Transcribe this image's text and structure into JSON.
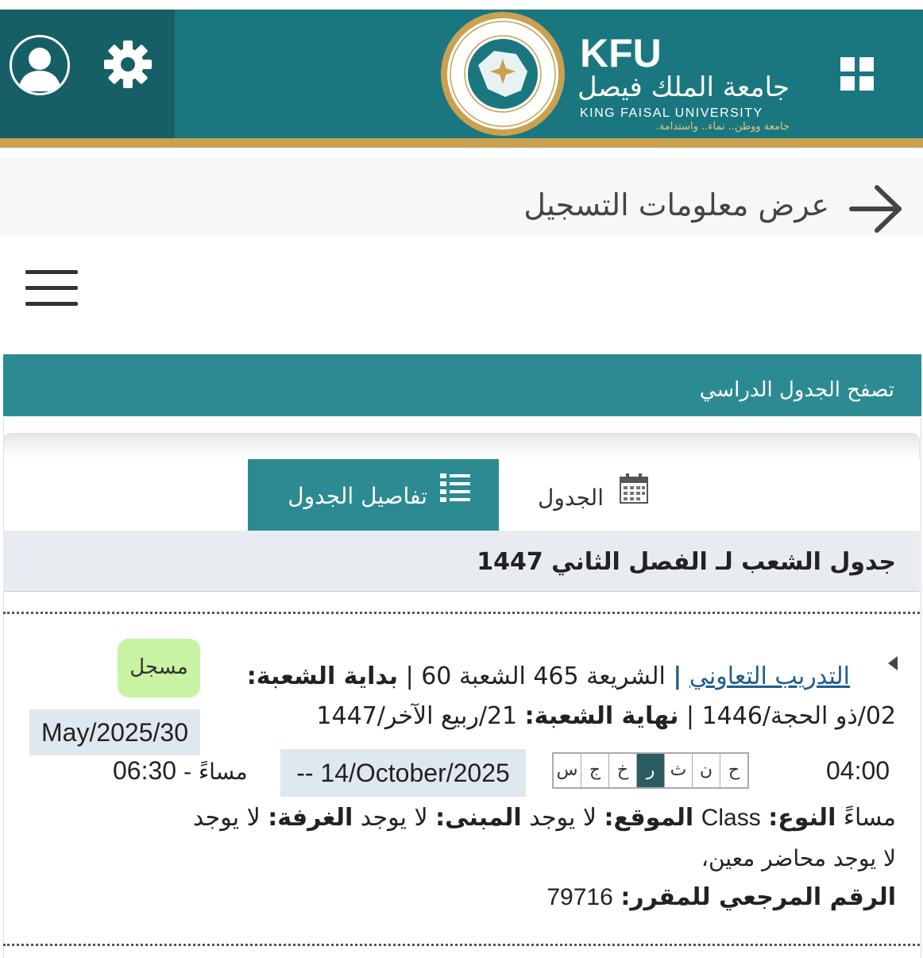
{
  "header": {
    "brand_abbr": "KFU",
    "brand_name_ar": "جامعة الملك فيصل",
    "brand_name_en": "KING FAISAL UNIVERSITY",
    "brand_tagline_ar": "جامعة ووطن.. نماء.. واستدامة.",
    "seal_text_ar": "جامعة الملك فيصل",
    "seal_text_en": "KING FAISAL UNIVERSITY",
    "seal_center": "KFU",
    "colors": {
      "bar": "#1a7780",
      "left_block": "#165f67",
      "gold": "#c9a14f"
    },
    "icons": {
      "avatar": "user-avatar-icon",
      "settings": "gear-icon",
      "apps": "apps-grid-icon"
    }
  },
  "page": {
    "title": "عرض معلومات التسجيل",
    "back_icon": "arrow-right-icon",
    "menu_icon": "hamburger-menu-icon"
  },
  "browse": {
    "title": "تصفح الجدول الدراسي"
  },
  "tabs": {
    "details_label": "تفاصيل الجدول",
    "schedule_label": "الجدول",
    "details_icon": "list-icon",
    "schedule_icon": "calendar-icon",
    "active": "details"
  },
  "term": {
    "title": "جدول الشعب لـ الفصل الثاني 1447"
  },
  "course": {
    "name": "التدريب التعاوني",
    "subject_code": "الشريعة 465",
    "section": "الشعبة 60",
    "start_label": "بداية الشعبة:",
    "start_date_hijri": "02/ذو الحجة/1446",
    "end_label": "نهاية الشعبة:",
    "end_date_hijri": "21/ربيع الآخر/1447",
    "status": "مسجل",
    "start_date_greg": "May/2025/30",
    "end_date_greg": "-- 14/October/2025",
    "days": [
      {
        "label": "ح",
        "active": false
      },
      {
        "label": "ن",
        "active": false
      },
      {
        "label": "ث",
        "active": false
      },
      {
        "label": "ر",
        "active": true
      },
      {
        "label": "خ",
        "active": false
      },
      {
        "label": "ج",
        "active": false
      },
      {
        "label": "س",
        "active": false
      }
    ],
    "time_start": "04:00",
    "time_end_prefix": "مساءً -",
    "time_end": "06:30",
    "pm_label": "مساءً",
    "type_label": "النوع:",
    "type_value": "Class",
    "location_label": "الموقع:",
    "location_value": "لا يوجد",
    "building_label": "المبنى:",
    "building_value": "لا يوجد",
    "room_label": "الغرفة:",
    "room_value": "لا يوجد",
    "instructor": "لا يوجد محاضر معين،",
    "crn_label": "الرقم المرجعي للمقرر:",
    "crn": "79716",
    "colors": {
      "link": "#1f5d8f",
      "badge": "#c8f3a3",
      "active_day": "#2b5c62"
    }
  }
}
